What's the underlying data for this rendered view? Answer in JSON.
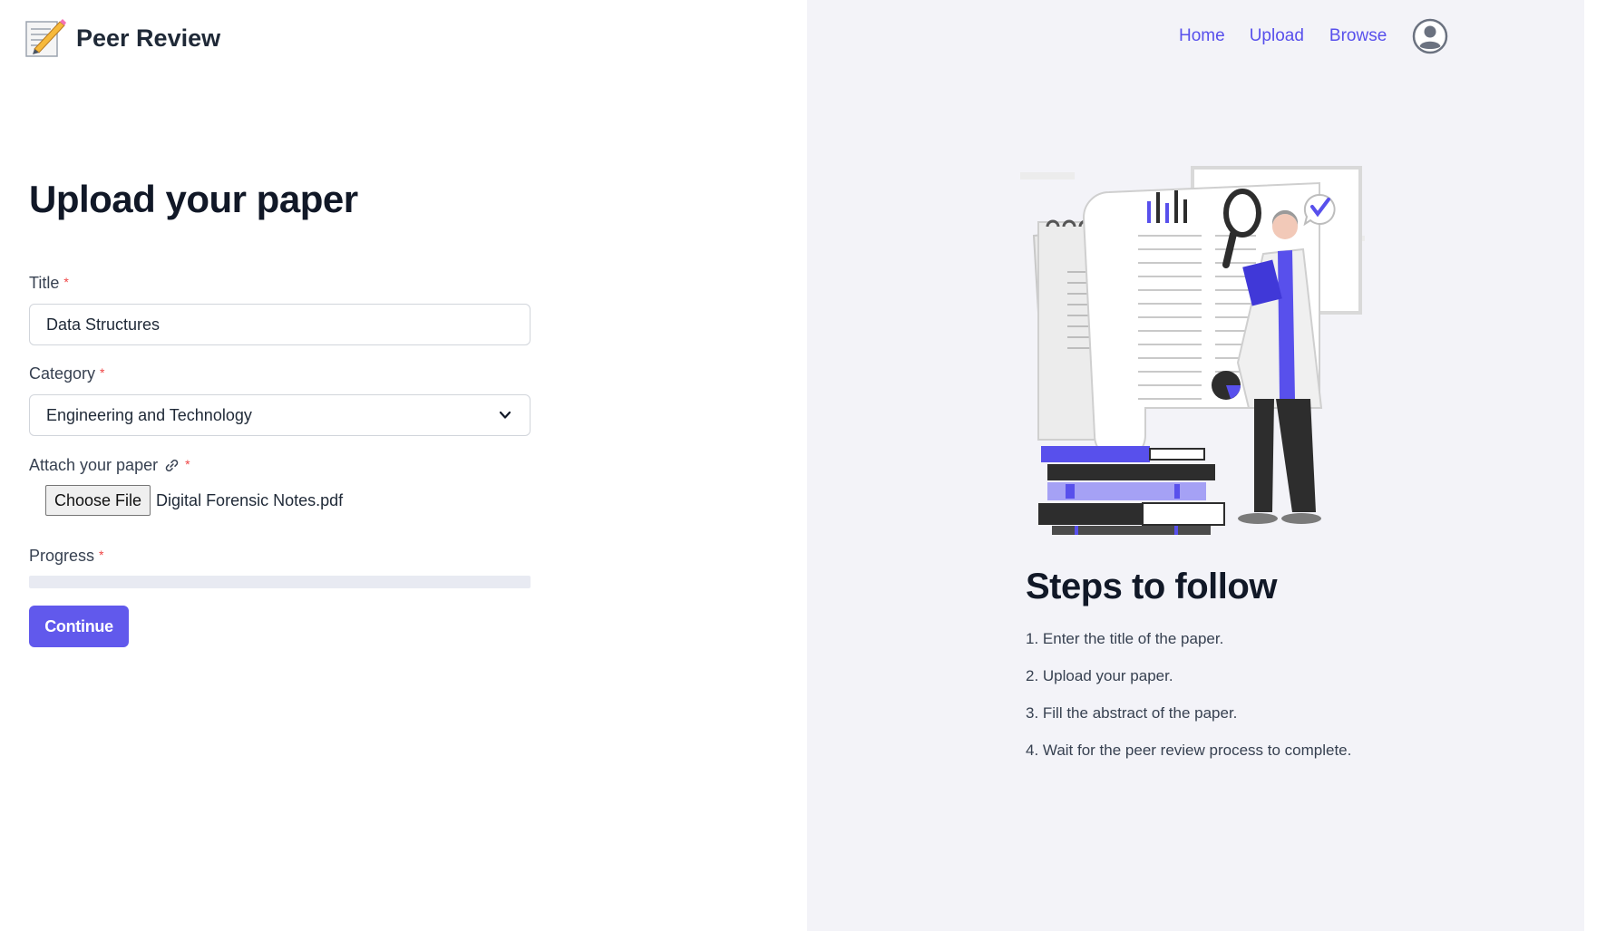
{
  "app": {
    "name": "Peer Review",
    "logo_icon": "memo-pencil-icon"
  },
  "nav": {
    "items": [
      {
        "label": "Home"
      },
      {
        "label": "Upload"
      },
      {
        "label": "Browse"
      }
    ],
    "avatar_icon": "user-avatar-icon",
    "link_color": "#5850ec"
  },
  "form": {
    "heading": "Upload your paper",
    "title": {
      "label": "Title",
      "required_mark": "*",
      "value": "Data Structures"
    },
    "category": {
      "label": "Category",
      "required_mark": "*",
      "selected": "Engineering and Technology"
    },
    "attachment": {
      "label": "Attach your paper",
      "icon": "link-icon",
      "required_mark": "*",
      "button_label": "Choose File",
      "file_name": "Digital Forensic Notes.pdf"
    },
    "progress": {
      "label": "Progress",
      "required_mark": "*",
      "percent": 0
    },
    "submit_label": "Continue",
    "accent_color": "#6159ec"
  },
  "steps": {
    "title": "Steps to follow",
    "items": [
      "1. Enter the title of the paper.",
      "2. Upload your paper.",
      "3. Fill the abstract of the paper.",
      "4. Wait for the peer review process to complete."
    ]
  }
}
